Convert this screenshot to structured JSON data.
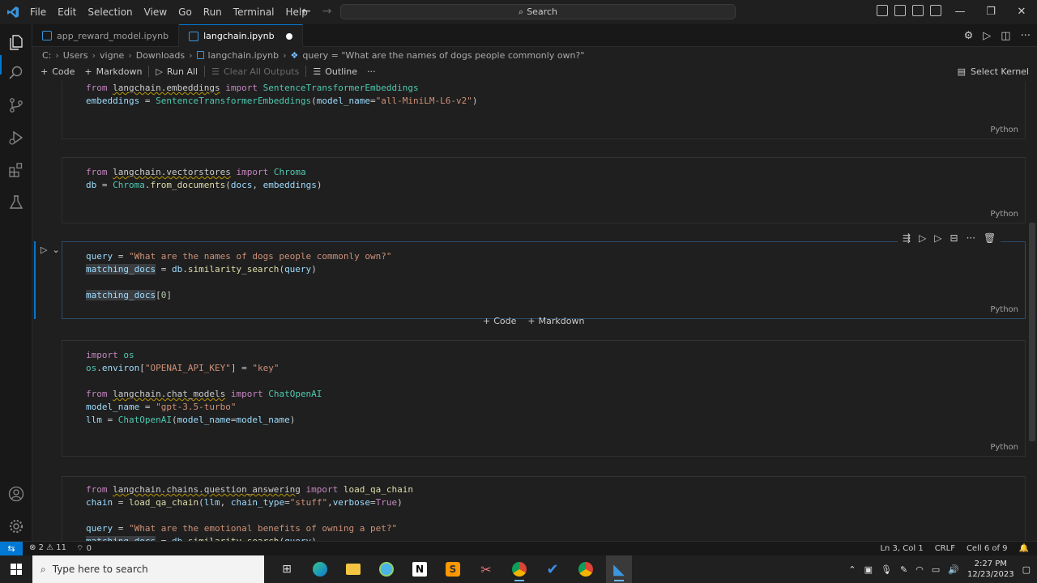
{
  "window": {
    "menu": [
      "File",
      "Edit",
      "Selection",
      "View",
      "Go",
      "Run",
      "Terminal",
      "Help"
    ],
    "search_label": "Search"
  },
  "tabs": [
    {
      "label": "app_reward_model.ipynb",
      "active": false
    },
    {
      "label": "langchain.ipynb",
      "active": true,
      "unsaved": true
    }
  ],
  "breadcrumb": [
    "C:",
    "Users",
    "vigne",
    "Downloads",
    "langchain.ipynb",
    "query = \"What are the names of dogs people commonly own?\""
  ],
  "toolbar": {
    "code_label": "Code",
    "markdown_label": "Markdown",
    "run_all_label": "Run All",
    "clear_outputs_label": "Clear All Outputs",
    "outline_label": "Outline",
    "more_label": "···",
    "kernel_label": "Select Kernel"
  },
  "cells": [
    {
      "lang": "Python",
      "lines": [
        "from langchain.embeddings import SentenceTransformerEmbeddings",
        "embeddings = SentenceTransformerEmbeddings(model_name=\"all-MiniLM-L6-v2\")"
      ]
    },
    {
      "lang": "Python",
      "lines": [
        "from langchain.vectorstores import Chroma",
        "db = Chroma.from_documents(docs, embeddings)"
      ]
    },
    {
      "lang": "Python",
      "lines": [
        "query = \"What are the names of dogs people commonly own?\"",
        "matching_docs = db.similarity_search(query)",
        "",
        "matching_docs[0]"
      ]
    },
    {
      "lang": "Python",
      "lines": [
        "import os",
        "os.environ[\"OPENAI_API_KEY\"] = \"key\"",
        "",
        "from langchain.chat_models import ChatOpenAI",
        "model_name = \"gpt-3.5-turbo\"",
        "llm = ChatOpenAI(model_name=model_name)"
      ]
    },
    {
      "lang": "",
      "lines": [
        "from langchain.chains.question_answering import load_qa_chain",
        "chain = load_qa_chain(llm, chain_type=\"stuff\",verbose=True)",
        "",
        "query = \"What are the emotional benefits of owning a pet?\"",
        "matching_docs = db.similarity_search(query)"
      ]
    }
  ],
  "add_cell": {
    "code_label": "Code",
    "markdown_label": "Markdown"
  },
  "status": {
    "errors": "2",
    "warnings": "11",
    "ports": "0",
    "position": "Ln 3, Col 1",
    "eol": "CRLF",
    "cell": "Cell 6 of 9"
  },
  "taskbar": {
    "search_placeholder": "Type here to search",
    "time": "2:27 PM",
    "date": "12/23/2023"
  }
}
